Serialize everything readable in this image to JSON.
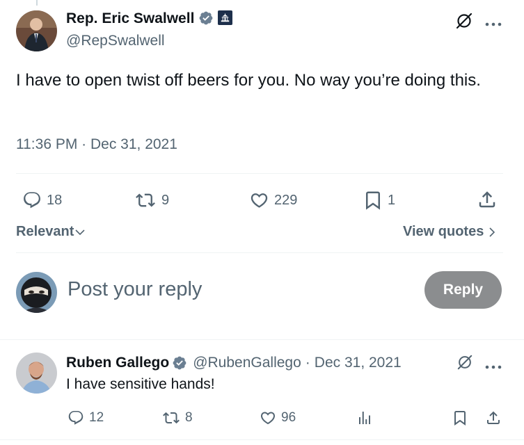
{
  "main_tweet": {
    "author_name": "Rep. Eric Swalwell",
    "handle": "@RepSwalwell",
    "text": "I have to open twist off beers for you. No way you’re doing this.",
    "timestamp": "11:36 PM · Dec 31, 2021",
    "stats": {
      "replies": "18",
      "retweets": "9",
      "likes": "229",
      "bookmarks": "1"
    }
  },
  "controls": {
    "sort_label": "Relevant",
    "view_quotes_label": "View quotes"
  },
  "composer": {
    "placeholder": "Post your reply",
    "reply_label": "Reply"
  },
  "reply_tweet": {
    "author_name": "Ruben Gallego",
    "handle": "@RubenGallego",
    "separator": "·",
    "date": "Dec 31, 2021",
    "text": "I have sensitive hands!",
    "stats": {
      "replies": "12",
      "retweets": "8",
      "likes": "96"
    }
  },
  "colors": {
    "verified_blue": "#6b7f92",
    "text_primary": "#0f1419",
    "text_secondary": "#536471",
    "reply_button": "#8b8d8f"
  },
  "icons": [
    "grok-icon",
    "more-icon",
    "verified-badge-icon",
    "government-badge-icon",
    "reply-icon",
    "retweet-icon",
    "like-icon",
    "bookmark-icon",
    "share-icon",
    "views-icon",
    "chevron-down-icon",
    "chevron-right-icon"
  ]
}
